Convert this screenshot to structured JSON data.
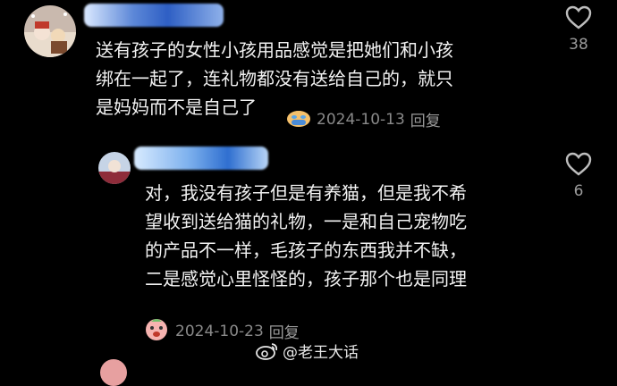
{
  "comments": [
    {
      "text": "送有孩子的女性小孩用品感觉是把她们和小孩\n绑在一起了，连礼物都没有送给自己的，就只\n是妈妈而不是自己了",
      "emoji_icon": "crying-face-icon",
      "date": "2024-10-13",
      "reply_label": "回复",
      "likes": "38"
    },
    {
      "text": "对，我没有孩子但是有养猫，但是我不希\n望收到送给猫的礼物，一是和自己宠物吃\n的产品不一样，毛孩子的东西我并不缺，\n二是感觉心里怪怪的，孩子那个也是同理",
      "emoji_icon": "shocked-face-icon",
      "date": "2024-10-23",
      "reply_label": "回复",
      "likes": "6"
    }
  ],
  "watermark": {
    "icon": "weibo-icon",
    "text": "@老王大话"
  }
}
